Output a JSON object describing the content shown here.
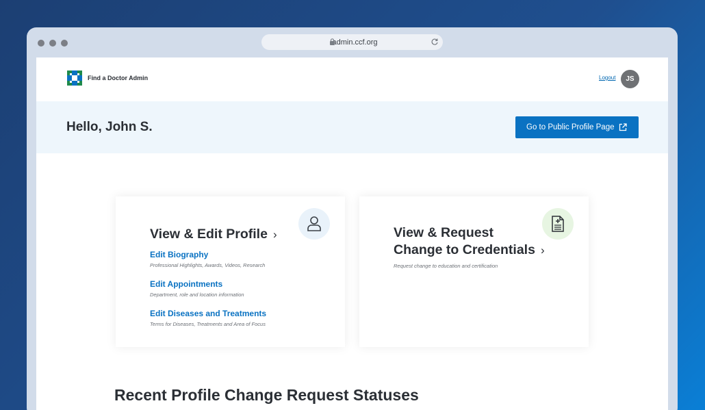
{
  "browser": {
    "url": "admin.ccf.org"
  },
  "header": {
    "brand": "Find a Doctor Admin",
    "logout_label": "Logout",
    "avatar_initials": "JS"
  },
  "hero": {
    "greeting": "Hello, John S.",
    "public_profile_button": "Go to Public Profile Page"
  },
  "cards": {
    "profile": {
      "title": "View & Edit Profile",
      "links": [
        {
          "label": "Edit Biography",
          "description": "Professional Highlights, Awards, Videos, Research"
        },
        {
          "label": "Edit Appointments",
          "description": "Department, role and location information"
        },
        {
          "label": "Edit Diseases and Treatments",
          "description": "Terms for Diseases, Treatments and Area of Focus"
        }
      ],
      "icon": "user-icon"
    },
    "credentials": {
      "title_line1": "View & Request",
      "title_line2": "Change to Credentials",
      "description": "Request change to education and certification",
      "icon": "document-plus-icon"
    }
  },
  "recent": {
    "title": "Recent Profile Change Request Statuses"
  },
  "colors": {
    "accent": "#0a72c2",
    "hero_bg": "#eef6fc",
    "logo_green": "#1f8a4c",
    "logo_blue": "#0a72c2"
  }
}
